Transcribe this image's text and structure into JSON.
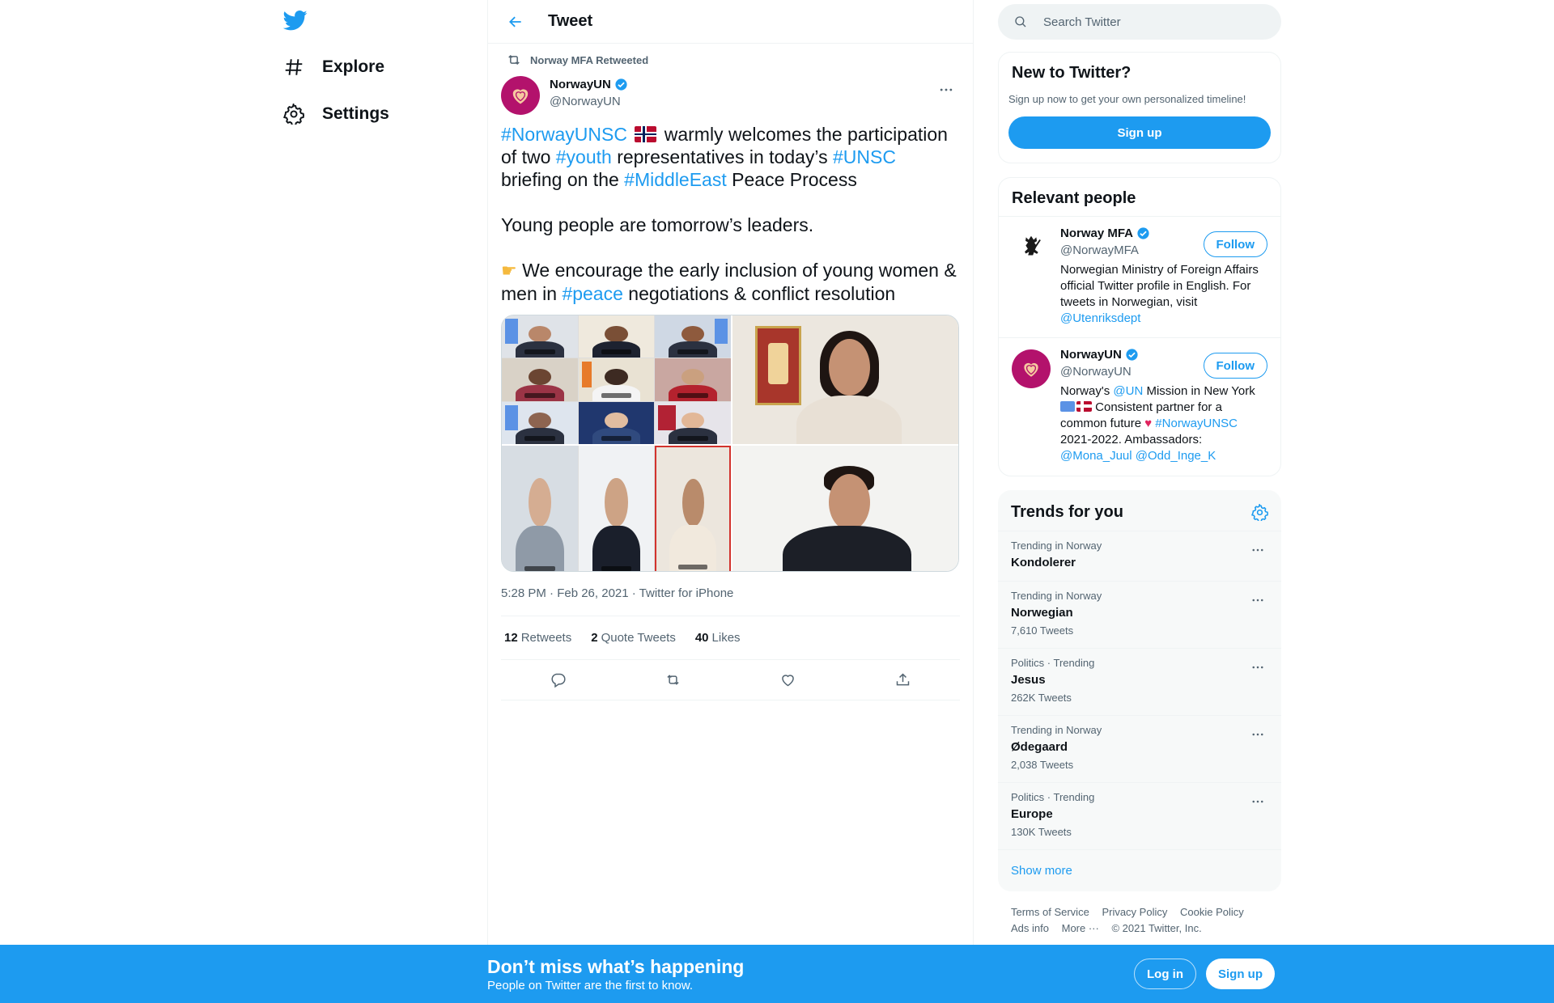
{
  "colors": {
    "accent": "#1d9bf0",
    "text": "#0f1419",
    "muted": "#536471",
    "brand_avatar": "#b3126c",
    "bottom_bar": "#1d9bf0"
  },
  "nav": {
    "logo_icon": "twitter-bird-icon",
    "items": [
      {
        "label": "Explore",
        "icon": "hashtag-icon"
      },
      {
        "label": "Settings",
        "icon": "gear-icon"
      }
    ]
  },
  "header": {
    "title": "Tweet",
    "back_icon": "arrow-left-icon"
  },
  "tweet": {
    "retweeted_by": "Norway MFA Retweeted",
    "author_name": "NorwayUN",
    "author_handle": "@NorwayUN",
    "text": {
      "l1_tag": "#NorwayUNSC",
      "l1_rest": " warmly welcomes the participation of two ",
      "tag_youth": "#youth",
      "l1_mid": " representatives in today’s ",
      "tag_unsc": "#UNSC",
      "l2_pre": " briefing on the ",
      "tag_me": "#MiddleEast",
      "l2_rest": " Peace Process",
      "p2": "Young people are tomorrow’s leaders.",
      "p3_pre": " We encourage the early inclusion of young women & men in ",
      "tag_peace": "#peace",
      "p3_rest": " negotiations & conflict resolution"
    },
    "meta": "5:28 PM · Feb 26, 2021 · Twitter for iPhone",
    "stats": [
      {
        "count": "12",
        "label": "Retweets"
      },
      {
        "count": "2",
        "label": "Quote Tweets"
      },
      {
        "count": "40",
        "label": "Likes"
      }
    ],
    "actions": [
      "reply-icon",
      "retweet-icon",
      "like-icon",
      "share-icon"
    ]
  },
  "search": {
    "placeholder": "Search Twitter"
  },
  "new_to_twitter": {
    "title": "New to Twitter?",
    "subtitle": "Sign up now to get your own personalized timeline!",
    "button": "Sign up"
  },
  "relevant_people": {
    "title": "Relevant people",
    "people": [
      {
        "name": "Norway MFA",
        "handle": "@NorwayMFA",
        "follow": "Follow",
        "bio": "Norwegian Ministry of Foreign Affairs official Twitter profile in English. For tweets in Norwegian, visit ",
        "bio_link": "@Utenriksdept"
      },
      {
        "name": "NorwayUN",
        "handle": "@NorwayUN",
        "follow": "Follow",
        "bio_1": "Norway's ",
        "bio_link_un": "@UN",
        "bio_2": " Mission in New York ",
        "bio_3": " Consistent partner for a common future ",
        "bio_tag": "#NorwayUNSC",
        "bio_4": " 2021-2022. Ambassadors: ",
        "bio_amb1": "@Mona_Juul",
        "bio_amb2": "@Odd_Inge_K"
      }
    ]
  },
  "trends": {
    "title": "Trends for you",
    "items": [
      {
        "context": "Trending in Norway",
        "name": "Kondolerer",
        "count": ""
      },
      {
        "context": "Trending in Norway",
        "name": "Norwegian",
        "count": "7,610 Tweets"
      },
      {
        "context": "Politics · Trending",
        "name": "Jesus",
        "count": "262K Tweets"
      },
      {
        "context": "Trending in Norway",
        "name": "Ødegaard",
        "count": "2,038 Tweets"
      },
      {
        "context": "Politics · Trending",
        "name": "Europe",
        "count": "130K Tweets"
      }
    ],
    "show_more": "Show more"
  },
  "footer": {
    "terms": "Terms of Service",
    "privacy": "Privacy Policy",
    "cookie": "Cookie Policy",
    "ads": "Ads info",
    "more": "More ···",
    "copyright": "© 2021 Twitter, Inc."
  },
  "bottom_bar": {
    "title": "Don’t miss what’s happening",
    "subtitle": "People on Twitter are the first to know.",
    "login": "Log in",
    "signup": "Sign up"
  }
}
